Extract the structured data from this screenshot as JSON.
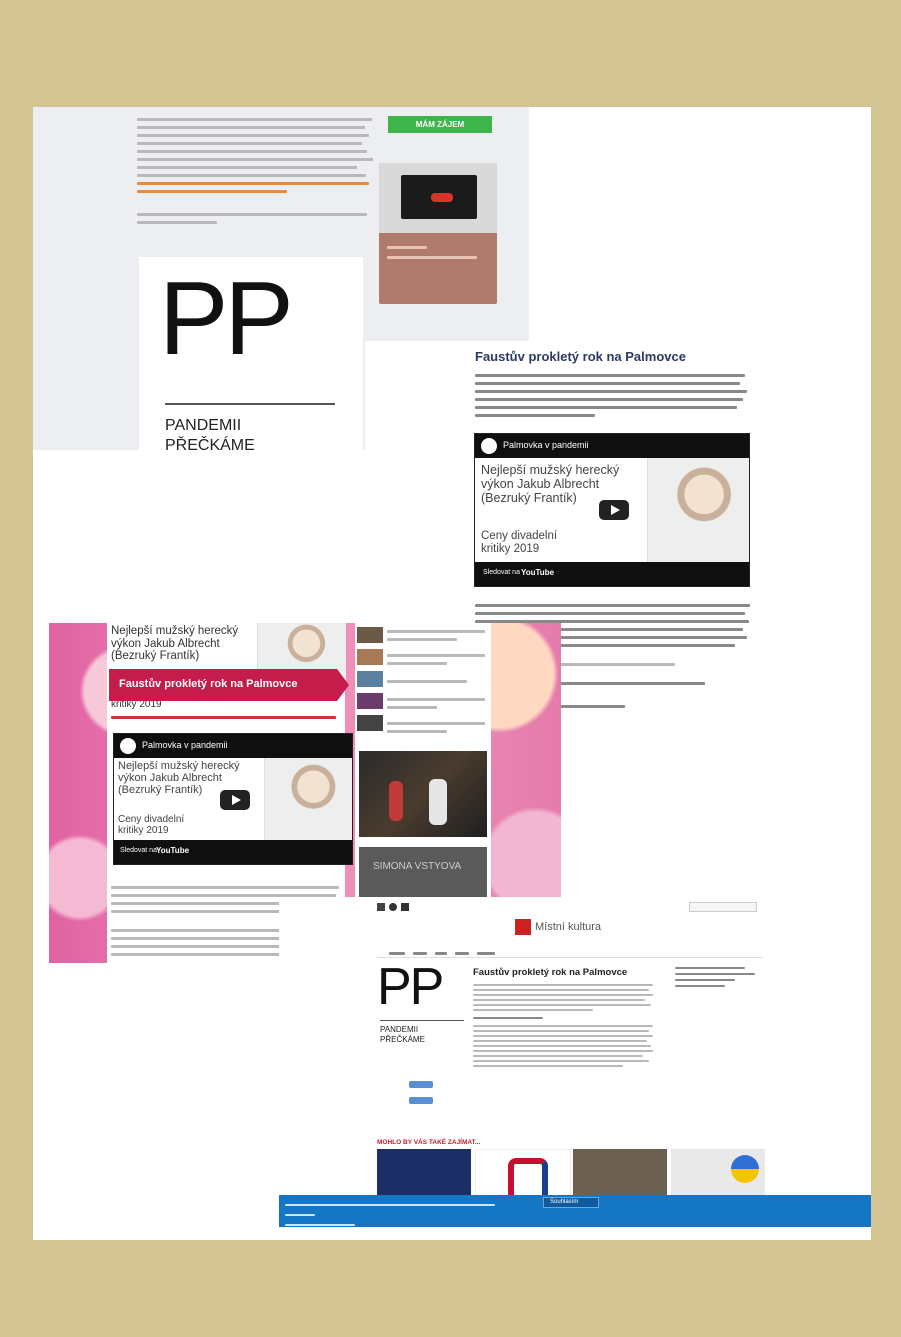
{
  "page": {
    "background": "#d3c593"
  },
  "shot1": {
    "button_label": "MÁM ZÁJEM",
    "logo_letters": "PP",
    "logo_line1": "PANDEMII",
    "logo_line2": "PŘEČKÁME"
  },
  "shot2": {
    "title": "Faustův prokletý rok na Palmovce",
    "video": {
      "channel": "Palmovka v pandemii",
      "headline": "Nejlepší mužský herecký výkon Jakub Albrecht (Bezruký Frantík)",
      "subline": "Ceny divadelní kritiky 2019",
      "watch_on": "Sledovat na",
      "youtube": "YouTube"
    }
  },
  "shot3": {
    "headline_top": "Nejlepší mužský herecký výkon Jakub Albrecht (Bezruký Frantík)",
    "banner_title": "Faustův prokletý rok na Palmovce",
    "subline": "kritiky 2019",
    "video": {
      "channel": "Palmovka v pandemii",
      "headline": "Nejlepší mužský herecký výkon Jakub Albrecht (Bezruký Frantík)",
      "subline": "Ceny divadelní kritiky 2019",
      "watch_on": "Sledovat na",
      "youtube": "YouTube"
    },
    "side_banner": "SIMONA VSTYOVA"
  },
  "shot4": {
    "site_name": "Místní kultura",
    "title": "Faustův prokletý rok na Palmovce",
    "logo_letters": "PP",
    "logo_line1": "PANDEMII",
    "logo_line2": "PŘEČKÁME",
    "related_heading": "MOHLO BY VÁS TAKÉ ZAJÍMAT...",
    "cookie_text": "Souhlasím"
  }
}
